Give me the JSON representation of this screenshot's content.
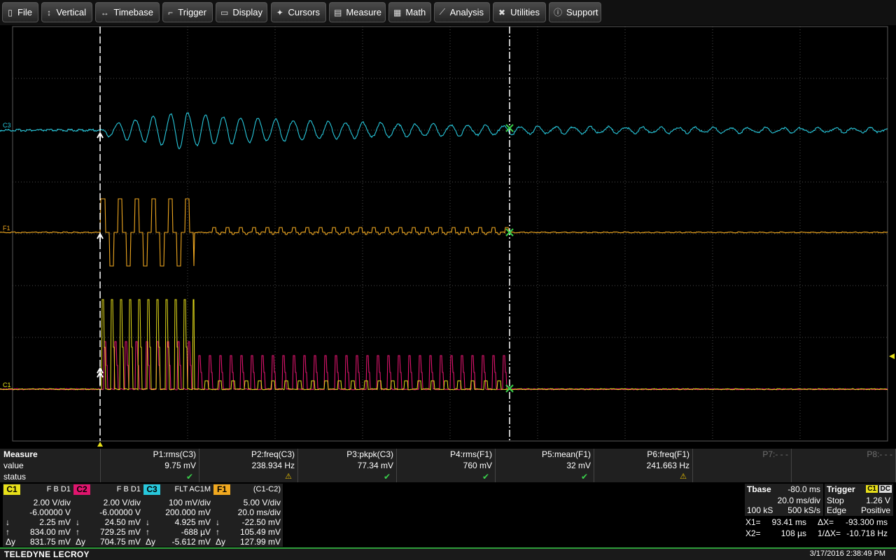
{
  "menu": {
    "items": [
      {
        "label": "File",
        "icon": "file-icon"
      },
      {
        "label": "Vertical",
        "icon": "vertical-arrows-icon"
      },
      {
        "label": "Timebase",
        "icon": "horizontal-arrows-icon"
      },
      {
        "label": "Trigger",
        "icon": "trigger-icon"
      },
      {
        "label": "Display",
        "icon": "display-icon"
      },
      {
        "label": "Cursors",
        "icon": "cursor-icon"
      },
      {
        "label": "Measure",
        "icon": "measure-icon"
      },
      {
        "label": "Math",
        "icon": "calculator-icon"
      },
      {
        "label": "Analysis",
        "icon": "analysis-icon"
      },
      {
        "label": "Utilities",
        "icon": "tools-icon"
      },
      {
        "label": "Support",
        "icon": "info-icon"
      }
    ]
  },
  "trace_labels": {
    "c3": "C3",
    "f1": "F1",
    "c1": "C1"
  },
  "colors": {
    "c1": "#e8e01a",
    "c2": "#e0156e",
    "c3": "#28c8dc",
    "f1": "#f0a820",
    "grid": "#5a5a5a",
    "cursor": "#ffffff",
    "ok": "#39d04b"
  },
  "measure": {
    "title": "Measure",
    "row_labels": [
      "value",
      "status"
    ],
    "params": [
      {
        "name": "P1:rms(C3)",
        "value": "9.75 mV",
        "status": "ok"
      },
      {
        "name": "P2:freq(C3)",
        "value": "238.934 Hz",
        "status": "warn"
      },
      {
        "name": "P3:pkpk(C3)",
        "value": "77.34 mV",
        "status": "ok"
      },
      {
        "name": "P4:rms(F1)",
        "value": "760 mV",
        "status": "ok"
      },
      {
        "name": "P5:mean(F1)",
        "value": "32 mV",
        "status": "ok"
      },
      {
        "name": "P6:freq(F1)",
        "value": "241.663 Hz",
        "status": "warn"
      },
      {
        "name": "P7:- - -",
        "value": "",
        "status": ""
      },
      {
        "name": "P8:- - -",
        "value": "",
        "status": ""
      }
    ],
    "ok_glyph": "✔",
    "warn_glyph": "⚠"
  },
  "channels": [
    {
      "tag": "C1",
      "header": "F  B  D1",
      "vdiv": "2.00 V/div",
      "offset": "-6.00000 V",
      "r1": {
        "lbl": "↓",
        "val": "2.25 mV"
      },
      "r2": {
        "lbl": "↑",
        "val": "834.00 mV"
      },
      "r3": {
        "lbl": "Δy",
        "val": "831.75 mV"
      }
    },
    {
      "tag": "C2",
      "header": "F  B  D1",
      "vdiv": "2.00 V/div",
      "offset": "-6.00000 V",
      "r1": {
        "lbl": "↓",
        "val": "24.50 mV"
      },
      "r2": {
        "lbl": "↑",
        "val": "729.25 mV"
      },
      "r3": {
        "lbl": "Δy",
        "val": "704.75 mV"
      }
    },
    {
      "tag": "C3",
      "header": "FLT  AC1M",
      "vdiv": "100 mV/div",
      "offset": "200.000 mV",
      "r1": {
        "lbl": "↓",
        "val": "4.925 mV"
      },
      "r2": {
        "lbl": "↑",
        "val": "-688 µV"
      },
      "r3": {
        "lbl": "Δy",
        "val": "-5.612 mV"
      }
    },
    {
      "tag": "F1",
      "header": "(C1-C2)",
      "vdiv": "5.00 V/div",
      "offset": "20.0 ms/div",
      "r1": {
        "lbl": "↓",
        "val": "-22.50 mV"
      },
      "r2": {
        "lbl": "↑",
        "val": "105.49 mV"
      },
      "r3": {
        "lbl": "Δy",
        "val": "127.99 mV"
      }
    }
  ],
  "timebase": {
    "title": "Tbase",
    "delay": "-80.0 ms",
    "hdiv": "20.0 ms/div",
    "samples": "100 kS",
    "rate": "500 kS/s"
  },
  "trigger": {
    "title": "Trigger",
    "source": "C1",
    "coupling": "DC",
    "mode": "Stop",
    "level": "1.26 V",
    "type": "Edge",
    "slope": "Positive"
  },
  "cursors": {
    "x1_label": "X1=",
    "x1": "93.41 ms",
    "dx_label": "ΔX=",
    "dx": "-93.300 ms",
    "x2_label": "X2=",
    "x2": "108 µs",
    "inv_label": "1/ΔX=",
    "inv": "-10.718 Hz"
  },
  "footer": {
    "brand": "TELEDYNE LECROY",
    "timestamp": "3/17/2016 2:38:49 PM"
  }
}
